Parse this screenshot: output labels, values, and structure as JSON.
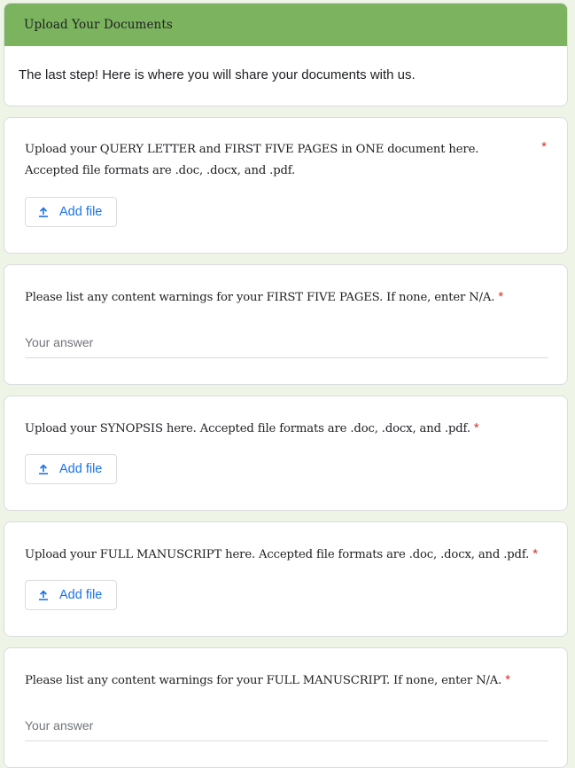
{
  "section": {
    "title": "Upload Your Documents",
    "description": "The last step! Here is where you will share your documents with us."
  },
  "questions": [
    {
      "text": "Upload your QUERY LETTER and FIRST FIVE PAGES in ONE document here. Accepted file formats are .doc, .docx, and .pdf.",
      "required_mark": "*",
      "button_label": "Add file"
    },
    {
      "text": "Please list any content warnings for your FIRST FIVE PAGES. If none, enter N/A.",
      "required_mark": "*",
      "placeholder": "Your answer"
    },
    {
      "text": "Upload your SYNOPSIS here. Accepted file formats are .doc, .docx, and .pdf.",
      "required_mark": "*",
      "button_label": "Add file"
    },
    {
      "text": "Upload your FULL MANUSCRIPT here. Accepted file formats are .doc, .docx, and .pdf.",
      "required_mark": "*",
      "button_label": "Add file"
    },
    {
      "text": "Please list any content warnings for your FULL MANUSCRIPT. If none, enter N/A.",
      "required_mark": "*",
      "placeholder": "Your answer"
    }
  ],
  "colors": {
    "header_background": "#7bb35e",
    "page_background": "#eef4e6",
    "accent_blue": "#1a73e8",
    "required_red": "#d93025"
  },
  "icons": {
    "upload": "upload-icon"
  }
}
